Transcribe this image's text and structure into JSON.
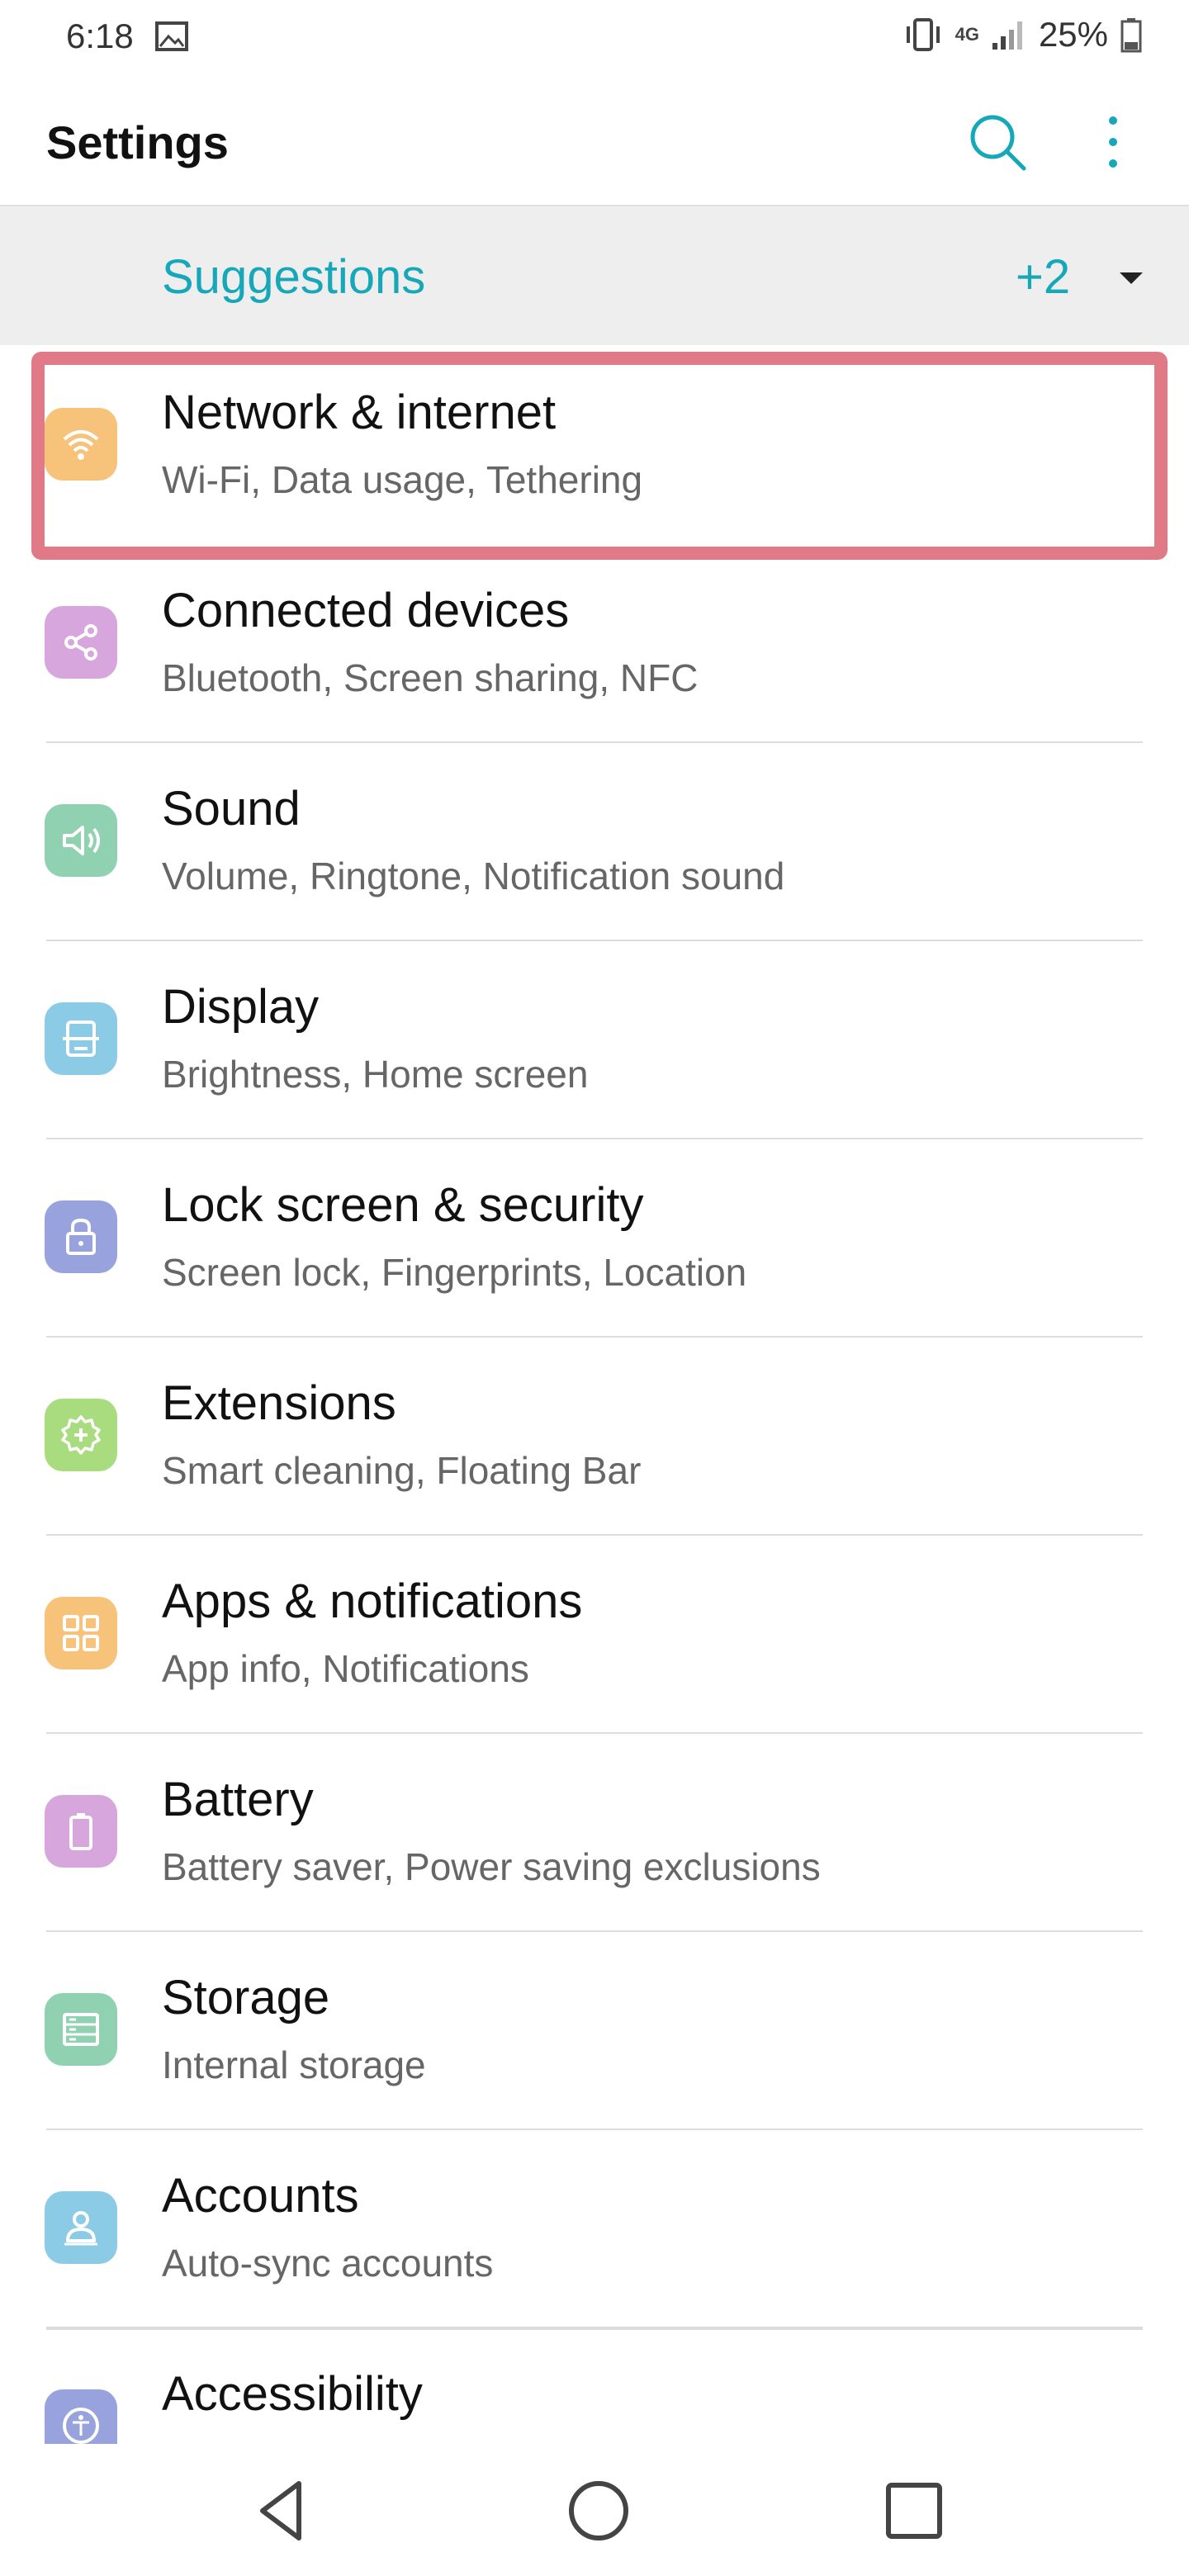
{
  "status_bar": {
    "time": "6:18",
    "network": "4G",
    "battery": "25%",
    "icons": [
      "image-icon",
      "vibrate-icon",
      "signal-icon",
      "battery-icon"
    ]
  },
  "app_bar": {
    "title": "Settings",
    "search_icon": "search-icon",
    "more_icon": "more-vert-icon"
  },
  "suggestions": {
    "label": "Suggestions",
    "count": "+2"
  },
  "accent_color": "#16a8b8",
  "highlight_color": "#e07a86",
  "items": [
    {
      "title": "Network & internet",
      "subtitle": "Wi-Fi, Data usage, Tethering",
      "icon": "wifi-icon",
      "color": "#f7c27a"
    },
    {
      "title": "Connected devices",
      "subtitle": "Bluetooth, Screen sharing, NFC",
      "icon": "share-icon",
      "color": "#d7a6dd"
    },
    {
      "title": "Sound",
      "subtitle": "Volume, Ringtone, Notification sound",
      "icon": "speaker-icon",
      "color": "#8fd1b0"
    },
    {
      "title": "Display",
      "subtitle": "Brightness, Home screen",
      "icon": "display-icon",
      "color": "#8ccbe6"
    },
    {
      "title": "Lock screen & security",
      "subtitle": "Screen lock, Fingerprints, Location",
      "icon": "lock-icon",
      "color": "#98a3de"
    },
    {
      "title": "Extensions",
      "subtitle": "Smart cleaning, Floating Bar",
      "icon": "gear-plus-icon",
      "color": "#a9dc7e"
    },
    {
      "title": "Apps & notifications",
      "subtitle": "App info, Notifications",
      "icon": "apps-grid-icon",
      "color": "#f7c27a"
    },
    {
      "title": "Battery",
      "subtitle": "Battery saver, Power saving exclusions",
      "icon": "battery-icon",
      "color": "#d7a6dd"
    },
    {
      "title": "Storage",
      "subtitle": "Internal storage",
      "icon": "storage-icon",
      "color": "#8fd1b0"
    },
    {
      "title": "Accounts",
      "subtitle": "Auto-sync accounts",
      "icon": "account-icon",
      "color": "#8ccbe6"
    },
    {
      "title": "Accessibility",
      "subtitle": "",
      "icon": "accessibility-icon",
      "color": "#98a3de"
    }
  ],
  "nav_bar": {
    "back": "back-icon",
    "home": "home-icon",
    "recents": "recents-icon"
  }
}
